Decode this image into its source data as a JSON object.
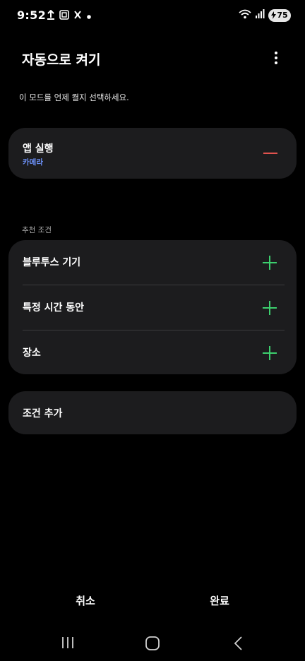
{
  "status_bar": {
    "time": "9:52",
    "battery": "75"
  },
  "header": {
    "title": "자동으로 켜기"
  },
  "subtitle": "이 모드를 언제 켤지 선택하세요.",
  "action": {
    "title": "앱 실행",
    "app": "카메라"
  },
  "suggested": {
    "label": "추천 조건",
    "items": [
      {
        "label": "블루투스 기기"
      },
      {
        "label": "특정 시간 동안"
      },
      {
        "label": "장소"
      }
    ]
  },
  "add_condition": {
    "label": "조건 추가"
  },
  "footer": {
    "cancel": "취소",
    "done": "완료"
  },
  "colors": {
    "accent_blue": "#6b8ff5",
    "plus_green": "#3ccf6e",
    "minus_red": "#e0524e",
    "card_bg": "#1c1c1e"
  },
  "icons": [
    "upload-icon",
    "screenshot-icon",
    "app-icon",
    "wifi-icon",
    "signal-icon",
    "battery-icon",
    "more-vert-icon",
    "minus-icon",
    "plus-icon",
    "nav-recent-icon",
    "nav-home-icon",
    "nav-back-icon"
  ]
}
